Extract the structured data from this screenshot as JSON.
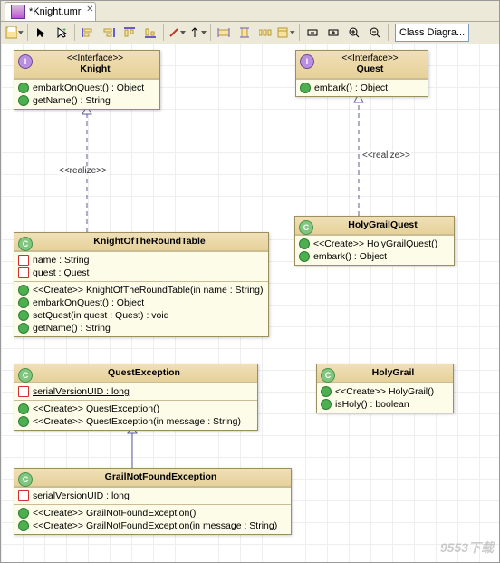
{
  "tab": {
    "title": "*Knight.umr"
  },
  "combo": {
    "value": "Class Diagra..."
  },
  "watermark": "9553下载",
  "relations": {
    "realize1": "<<realize>>",
    "realize2": "<<realize>>"
  },
  "classes": {
    "knight": {
      "stereotype": "<<Interface>>",
      "name": "Knight",
      "type": "interface",
      "attributes": [],
      "operations": [
        {
          "vis": "public",
          "sig": "embarkOnQuest() : Object"
        },
        {
          "vis": "public",
          "sig": "getName() : String"
        }
      ]
    },
    "quest": {
      "stereotype": "<<Interface>>",
      "name": "Quest",
      "type": "interface",
      "attributes": [],
      "operations": [
        {
          "vis": "public",
          "sig": "embark() : Object"
        }
      ]
    },
    "roundtable": {
      "stereotype": "",
      "name": "KnightOfTheRoundTable",
      "type": "class",
      "attributes": [
        {
          "vis": "private",
          "sig": "name : String"
        },
        {
          "vis": "private",
          "sig": "quest : Quest"
        }
      ],
      "operations": [
        {
          "vis": "public",
          "sig": "<<Create>> KnightOfTheRoundTable(in name : String)"
        },
        {
          "vis": "public",
          "sig": "embarkOnQuest() : Object"
        },
        {
          "vis": "public",
          "sig": "setQuest(in quest : Quest) : void"
        },
        {
          "vis": "public",
          "sig": "getName() : String"
        }
      ]
    },
    "holygrailquest": {
      "stereotype": "",
      "name": "HolyGrailQuest",
      "type": "class",
      "attributes": [],
      "operations": [
        {
          "vis": "public",
          "sig": "<<Create>> HolyGrailQuest()"
        },
        {
          "vis": "public",
          "sig": "embark() : Object"
        }
      ]
    },
    "questexception": {
      "stereotype": "",
      "name": "QuestException",
      "type": "class",
      "attributes": [
        {
          "vis": "private",
          "static": true,
          "sig": "serialVersionUID : long"
        }
      ],
      "operations": [
        {
          "vis": "public",
          "sig": "<<Create>> QuestException()"
        },
        {
          "vis": "public",
          "sig": "<<Create>> QuestException(in message : String)"
        }
      ]
    },
    "holygrail": {
      "stereotype": "",
      "name": "HolyGrail",
      "type": "class",
      "attributes": [],
      "operations": [
        {
          "vis": "public",
          "sig": "<<Create>> HolyGrail()"
        },
        {
          "vis": "public",
          "sig": "isHoly() : boolean"
        }
      ]
    },
    "grailnotfound": {
      "stereotype": "",
      "name": "GrailNotFoundException",
      "type": "class",
      "attributes": [
        {
          "vis": "private",
          "static": true,
          "sig": "serialVersionUID : long"
        }
      ],
      "operations": [
        {
          "vis": "public",
          "sig": "<<Create>> GrailNotFoundException()"
        },
        {
          "vis": "public",
          "sig": "<<Create>> GrailNotFoundException(in message : String)"
        }
      ]
    }
  },
  "chart_data": {
    "type": "uml-class-diagram",
    "title": "Knight.umr",
    "classes": [
      {
        "id": "Knight",
        "kind": "interface",
        "operations": [
          "embarkOnQuest() : Object",
          "getName() : String"
        ]
      },
      {
        "id": "Quest",
        "kind": "interface",
        "operations": [
          "embark() : Object"
        ]
      },
      {
        "id": "KnightOfTheRoundTable",
        "kind": "class",
        "attributes": [
          "- name : String",
          "- quest : Quest"
        ],
        "operations": [
          "<<Create>> KnightOfTheRoundTable(in name : String)",
          "embarkOnQuest() : Object",
          "setQuest(in quest : Quest) : void",
          "getName() : String"
        ]
      },
      {
        "id": "HolyGrailQuest",
        "kind": "class",
        "operations": [
          "<<Create>> HolyGrailQuest()",
          "embark() : Object"
        ]
      },
      {
        "id": "QuestException",
        "kind": "class",
        "attributes": [
          "- serialVersionUID : long"
        ],
        "operations": [
          "<<Create>> QuestException()",
          "<<Create>> QuestException(in message : String)"
        ]
      },
      {
        "id": "HolyGrail",
        "kind": "class",
        "operations": [
          "<<Create>> HolyGrail()",
          "isHoly() : boolean"
        ]
      },
      {
        "id": "GrailNotFoundException",
        "kind": "class",
        "attributes": [
          "- serialVersionUID : long"
        ],
        "operations": [
          "<<Create>> GrailNotFoundException()",
          "<<Create>> GrailNotFoundException(in message : String)"
        ]
      }
    ],
    "relations": [
      {
        "from": "KnightOfTheRoundTable",
        "to": "Knight",
        "type": "realization"
      },
      {
        "from": "HolyGrailQuest",
        "to": "Quest",
        "type": "realization"
      },
      {
        "from": "GrailNotFoundException",
        "to": "QuestException",
        "type": "generalization"
      }
    ]
  }
}
